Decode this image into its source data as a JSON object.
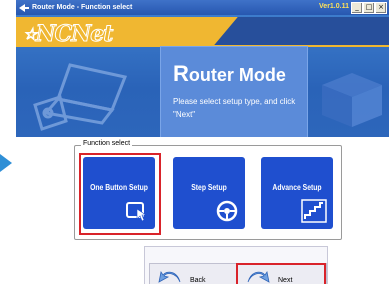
{
  "window": {
    "title": "Router Mode - Function select",
    "version": "Ver1.0.11",
    "controls": [
      "_",
      "□",
      "×"
    ]
  },
  "banner": {
    "logo": "NCNet",
    "mode_title_first": "R",
    "mode_title_rest": "outer Mode",
    "description": "Please select setup type, and click \"Next\""
  },
  "function_select": {
    "legend": "Function select",
    "options": [
      {
        "label": "One Button Setup",
        "icon": "hand-pointer-icon",
        "selected": true
      },
      {
        "label": "Step Setup",
        "icon": "steering-wheel-icon",
        "selected": false
      },
      {
        "label": "Advance Setup",
        "icon": "stairs-icon",
        "selected": false
      }
    ]
  },
  "nav": {
    "back_label": "Back",
    "next_label": "Next"
  },
  "colors": {
    "titlebar": "#2757b0",
    "banner": "#2a63b8",
    "accent": "#f0b731",
    "option_bg": "#1f4fcf",
    "highlight": "#d9232a"
  }
}
